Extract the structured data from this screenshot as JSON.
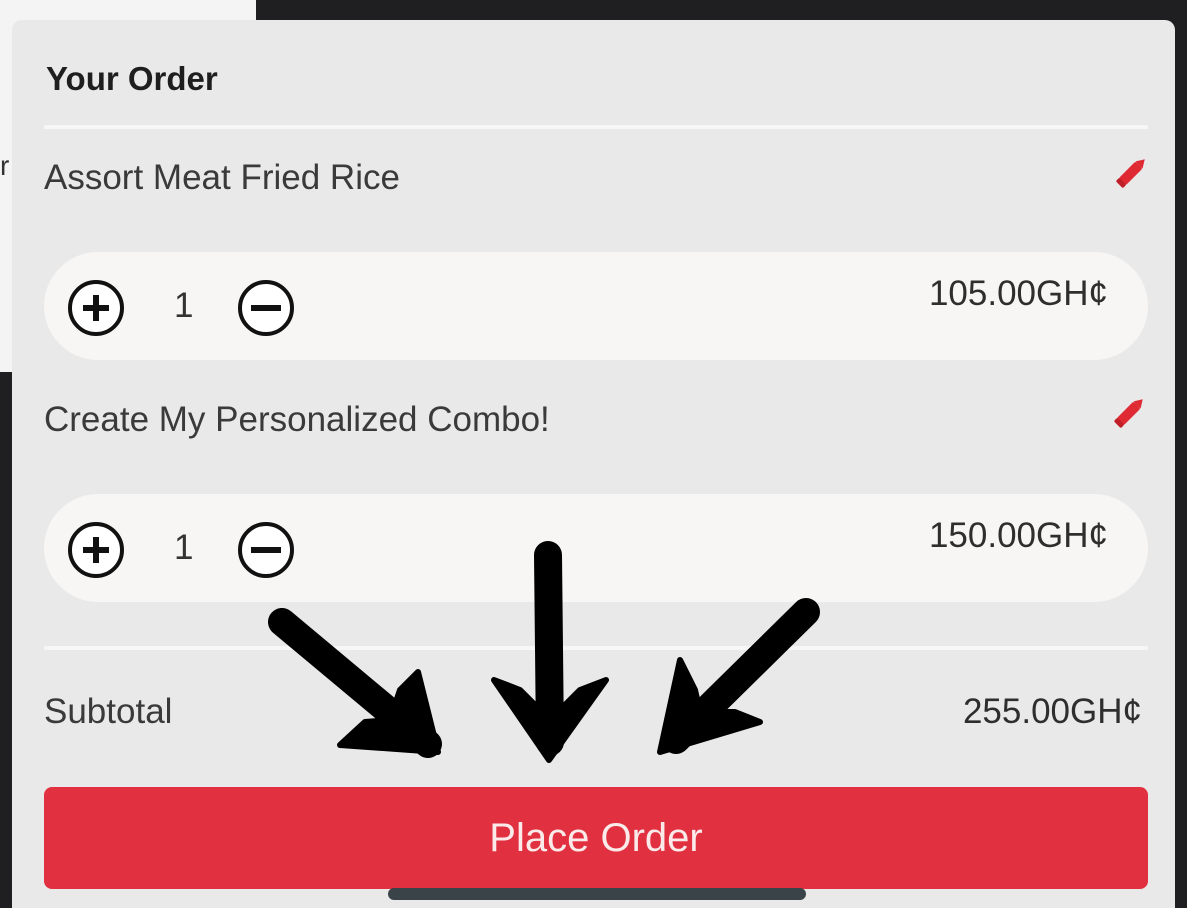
{
  "order": {
    "title": "Your Order",
    "items": [
      {
        "name": "Assort Meat Fried Rice",
        "quantity": "1",
        "price": "105.00GH¢"
      },
      {
        "name": "Create My Personalized Combo!",
        "quantity": "1",
        "price": "150.00GH¢"
      }
    ],
    "subtotal_label": "Subtotal",
    "subtotal_value": "255.00GH¢",
    "place_order_label": "Place Order"
  },
  "background": {
    "partial_glyph": "r"
  },
  "colors": {
    "accent": "#e1303f",
    "edit_icon": "#e02a33",
    "panel": "#e9e9ea",
    "row": "#f8f6f4"
  },
  "icons": {
    "edit": "pencil-icon",
    "increase": "plus-circle-icon",
    "decrease": "minus-circle-icon"
  },
  "annotation": {
    "arrow_count": 3,
    "points_to": "Place Order"
  }
}
